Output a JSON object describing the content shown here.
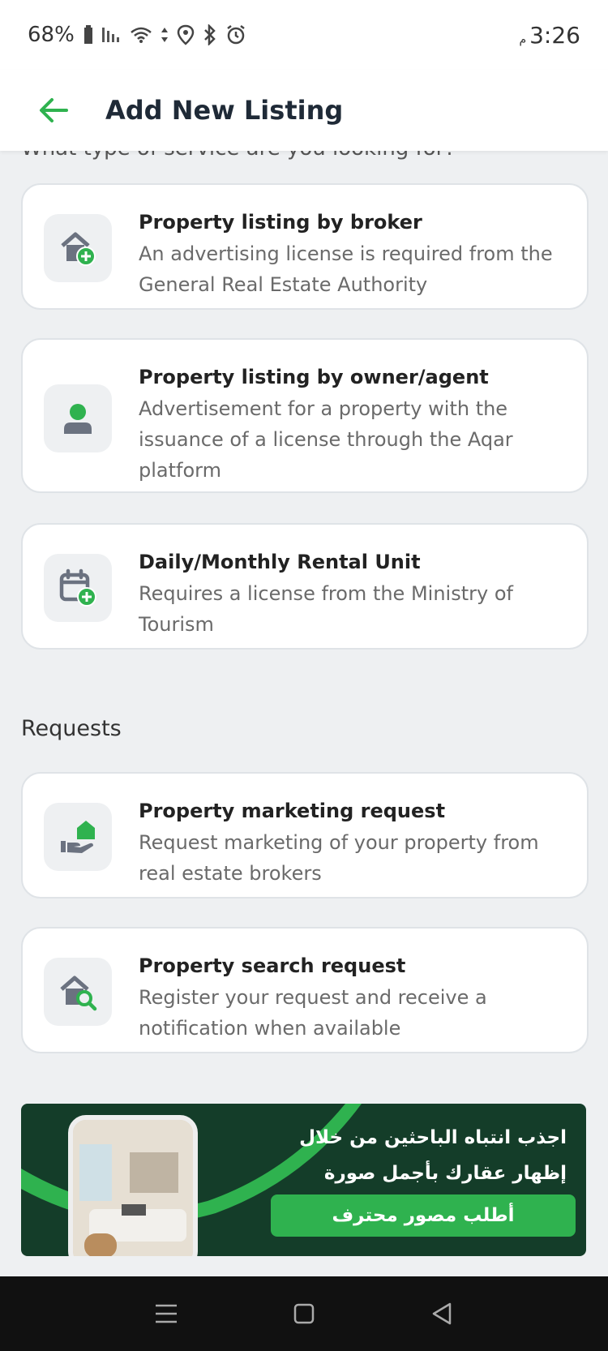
{
  "status_bar": {
    "battery": "68%",
    "time": "3:26",
    "time_suffix": "م"
  },
  "header": {
    "title": "Add New Listing",
    "back_icon": "arrow-left-icon"
  },
  "section_heading_partial": "What type of service are you looking for?",
  "listing_options": [
    {
      "title": "Property listing by broker",
      "description": "An advertising license is required from the General Real Estate Authority",
      "icon": "house-plus-icon"
    },
    {
      "title": "Property listing by owner/agent",
      "description": "Advertisement for a property with the issuance of a license through the Aqar platform",
      "icon": "person-icon"
    },
    {
      "title": "Daily/Monthly Rental Unit",
      "description": "Requires a license from the Ministry of Tourism",
      "icon": "calendar-plus-icon"
    }
  ],
  "requests": {
    "heading": "Requests",
    "items": [
      {
        "title": "Property marketing request",
        "description": "Request marketing of your property from real estate brokers",
        "icon": "hand-house-icon"
      },
      {
        "title": "Property search request",
        "description": "Register your request and receive a notification when available",
        "icon": "house-search-icon"
      }
    ]
  },
  "banner": {
    "line1": "اجذب انتباه الباحثين من خلال",
    "line2": "إظهار عقارك بأجمل صورة",
    "button": "أطلب مصور محترف"
  },
  "colors": {
    "accent": "#2fb24f",
    "icon_gray": "#6b7280",
    "banner_bg": "#143d29"
  }
}
